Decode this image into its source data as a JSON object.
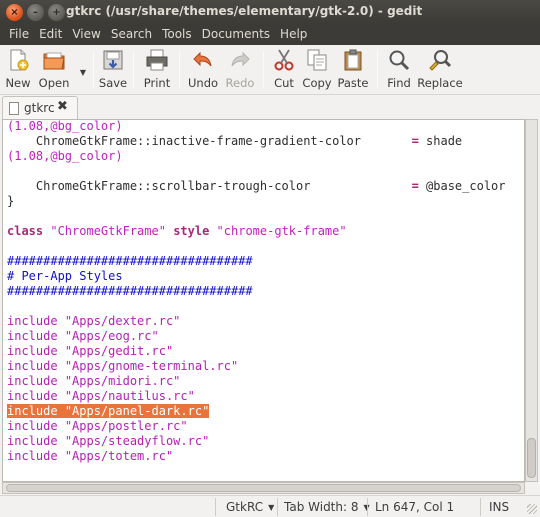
{
  "window": {
    "title": "gtkrc (/usr/share/themes/elementary/gtk-2.0) - gedit",
    "close_glyph": "×",
    "minimize_glyph": "–",
    "maximize_glyph": "+"
  },
  "menubar": [
    "File",
    "Edit",
    "View",
    "Search",
    "Tools",
    "Documents",
    "Help"
  ],
  "toolbar": {
    "new": "New",
    "open": "Open",
    "save": "Save",
    "print": "Print",
    "undo": "Undo",
    "redo": "Redo",
    "cut": "Cut",
    "copy": "Copy",
    "paste": "Paste",
    "find": "Find",
    "replace": "Replace"
  },
  "tab": {
    "label": "gtkrc"
  },
  "code": {
    "l1a": "(1.08,@bg_color)",
    "l2a": "    ChromeGtkFrame::inactive-frame-gradient-color       ",
    "l2b": "=",
    "l2c": " shade",
    "l3a": "(1.08,@bg_color)",
    "l5a": "    ChromeGtkFrame::scrollbar-trough-color              ",
    "l5b": "=",
    "l5c": " @base_color",
    "l6a": "}",
    "l8a": "class",
    "l8b": " ",
    "l8c": "\"ChromeGtkFrame\"",
    "l8d": " ",
    "l8e": "style",
    "l8f": " ",
    "l8g": "\"chrome-gtk-frame\"",
    "l10": "##################################",
    "l11": "# Per-App Styles",
    "l12": "##################################",
    "includes": [
      "\"Apps/dexter.rc\"",
      "\"Apps/eog.rc\"",
      "\"Apps/gedit.rc\"",
      "\"Apps/gnome-terminal.rc\"",
      "\"Apps/midori.rc\"",
      "\"Apps/nautilus.rc\"",
      "\"Apps/panel-dark.rc\"",
      "\"Apps/postler.rc\"",
      "\"Apps/steadyflow.rc\"",
      "\"Apps/totem.rc\""
    ],
    "include_kw": "include"
  },
  "statusbar": {
    "language": "GtkRC",
    "tab_width": "Tab Width: 8",
    "position": "Ln 647, Col 1",
    "mode": "INS"
  },
  "colors": {
    "highlight": "#e8743b",
    "keyword": "#a52a7a",
    "string": "#c21fc2",
    "comment": "#1010c8"
  }
}
